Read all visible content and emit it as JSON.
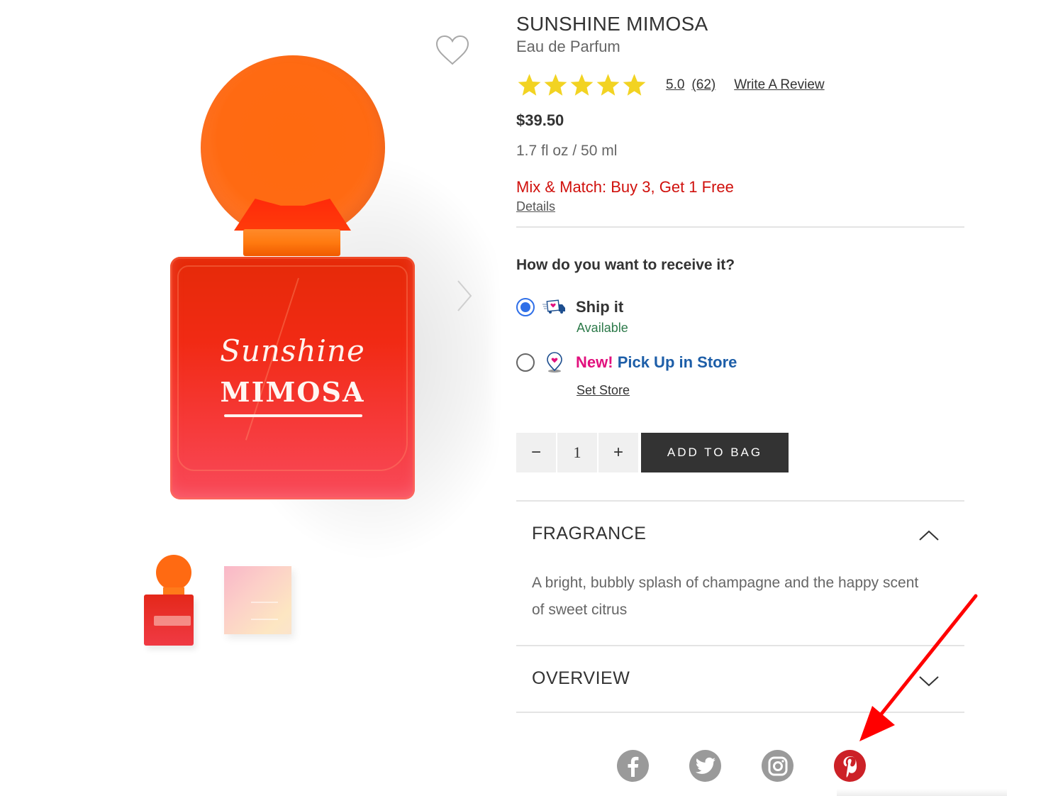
{
  "product": {
    "title": "SUNSHINE MIMOSA",
    "subtitle": "Eau de Parfum",
    "rating": {
      "value": "5.0",
      "count": "(62)",
      "stars": 5,
      "max_stars": 5,
      "write_review": "Write A Review"
    },
    "price": "$39.50",
    "size": "1.7 fl oz / 50 ml",
    "promo": {
      "text": "Mix & Match: Buy 3, Get 1 Free",
      "details_label": "Details"
    },
    "bottle_label": {
      "script": "Sunshine",
      "main": "MIMOSA"
    }
  },
  "gallery": {
    "wishlist_icon": "heart-outline-icon",
    "next_icon": "chevron-right-icon",
    "thumbnails": [
      {
        "name": "bottle-thumbnail"
      },
      {
        "name": "box-thumbnail"
      }
    ]
  },
  "receive": {
    "title": "How do you want to receive it?",
    "options": [
      {
        "label": "Ship it",
        "status": "Available",
        "selected": true,
        "icon": "delivery-truck-icon"
      },
      {
        "new_badge": "New!",
        "label": "Pick Up in Store",
        "link": "Set Store",
        "selected": false,
        "icon": "store-pin-icon"
      }
    ]
  },
  "cart": {
    "decrement": "−",
    "quantity": "1",
    "increment": "+",
    "add_to_bag": "ADD TO BAG"
  },
  "accordions": [
    {
      "title": "FRAGRANCE",
      "expanded": true,
      "body": "A bright, bubbly splash of champagne and the happy scent of sweet citrus"
    },
    {
      "title": "OVERVIEW",
      "expanded": false
    }
  ],
  "social": [
    {
      "name": "facebook",
      "icon": "facebook-icon"
    },
    {
      "name": "twitter",
      "icon": "twitter-icon"
    },
    {
      "name": "instagram",
      "icon": "instagram-icon"
    },
    {
      "name": "pinterest",
      "icon": "pinterest-icon"
    }
  ],
  "colors": {
    "star": "#f2d322",
    "promo_red": "#d0100c",
    "available_green": "#2d7a4a",
    "new_pink": "#e2107e",
    "pickup_blue": "#1d5ea8",
    "radio_blue": "#2f6fe8",
    "button_dark": "#333333",
    "pinterest_red": "#cc2127",
    "social_gray": "#9a9a9a",
    "annotation_red": "#ff0000"
  }
}
